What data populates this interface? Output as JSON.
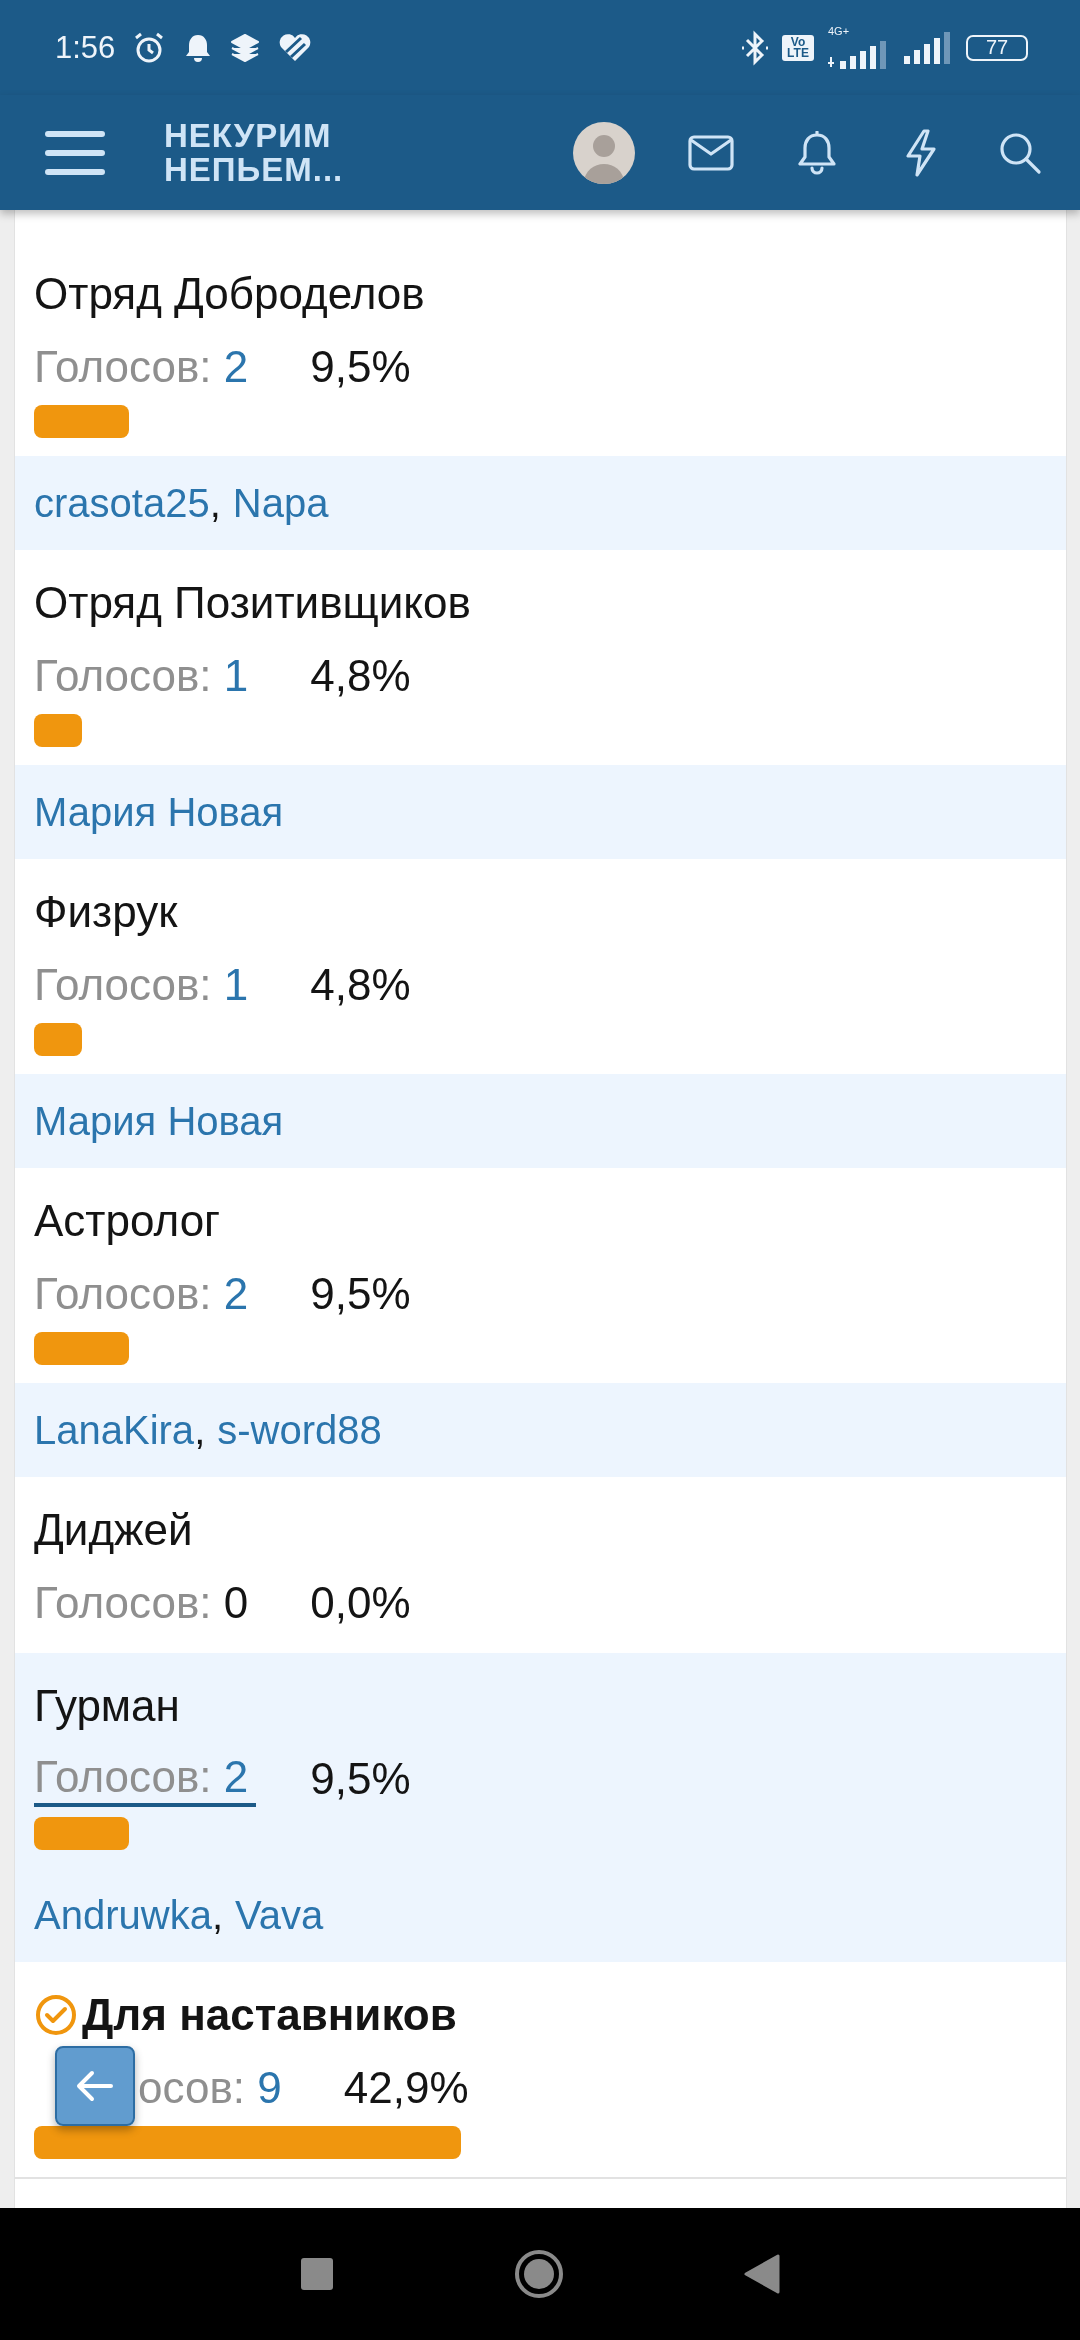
{
  "status_bar": {
    "time": "1:56",
    "network_badge": "Vo LTE",
    "network_type": "4G+",
    "battery": "77"
  },
  "header": {
    "logo": "НЕКУРИМ НЕПЬЕМ..."
  },
  "poll": {
    "voter_separator": ",",
    "options": [
      {
        "title": "Отряд Доброделов",
        "votes_label": "Голосов:",
        "votes": "2",
        "percent": "9,5%",
        "voted": false,
        "hovered": false,
        "voters": [
          "crasota25",
          "Napa"
        ]
      },
      {
        "title": "Отряд Позитивщиков",
        "votes_label": "Голосов:",
        "votes": "1",
        "percent": "4,8%",
        "voted": false,
        "hovered": false,
        "voters": [
          "Мария Новая"
        ]
      },
      {
        "title": "Физрук",
        "votes_label": "Голосов:",
        "votes": "1",
        "percent": "4,8%",
        "voted": false,
        "hovered": false,
        "voters": [
          "Мария Новая"
        ]
      },
      {
        "title": "Астролог",
        "votes_label": "Голосов:",
        "votes": "2",
        "percent": "9,5%",
        "voted": false,
        "hovered": false,
        "voters": [
          "LanaKira",
          "s-word88"
        ]
      },
      {
        "title": "Диджей",
        "votes_label": "Голосов:",
        "votes": "0",
        "percent": "0,0%",
        "voted": false,
        "hovered": false
      },
      {
        "title": "Гурман",
        "votes_label": "Голосов:",
        "votes": "2",
        "percent": "9,5%",
        "voted": false,
        "hovered": true,
        "voters": [
          "Andruwka",
          "Vava"
        ]
      },
      {
        "title": "Для наставников",
        "votes_label": "осов:",
        "votes": "9",
        "percent": "42,9%",
        "voted": true,
        "hovered": false,
        "covered": true
      }
    ]
  }
}
